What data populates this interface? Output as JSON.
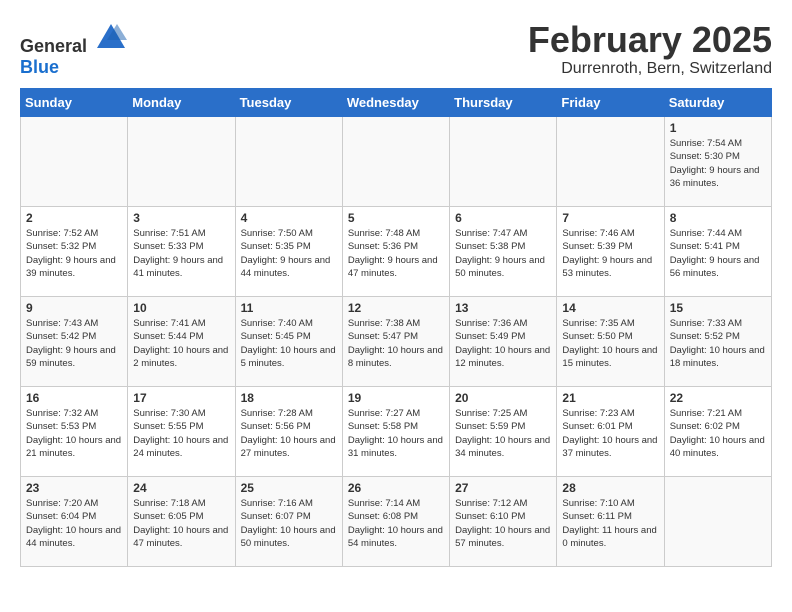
{
  "header": {
    "logo_general": "General",
    "logo_blue": "Blue",
    "title": "February 2025",
    "subtitle": "Durrenroth, Bern, Switzerland"
  },
  "days_of_week": [
    "Sunday",
    "Monday",
    "Tuesday",
    "Wednesday",
    "Thursday",
    "Friday",
    "Saturday"
  ],
  "weeks": [
    [
      {
        "day": "",
        "info": ""
      },
      {
        "day": "",
        "info": ""
      },
      {
        "day": "",
        "info": ""
      },
      {
        "day": "",
        "info": ""
      },
      {
        "day": "",
        "info": ""
      },
      {
        "day": "",
        "info": ""
      },
      {
        "day": "1",
        "info": "Sunrise: 7:54 AM\nSunset: 5:30 PM\nDaylight: 9 hours and 36 minutes."
      }
    ],
    [
      {
        "day": "2",
        "info": "Sunrise: 7:52 AM\nSunset: 5:32 PM\nDaylight: 9 hours and 39 minutes."
      },
      {
        "day": "3",
        "info": "Sunrise: 7:51 AM\nSunset: 5:33 PM\nDaylight: 9 hours and 41 minutes."
      },
      {
        "day": "4",
        "info": "Sunrise: 7:50 AM\nSunset: 5:35 PM\nDaylight: 9 hours and 44 minutes."
      },
      {
        "day": "5",
        "info": "Sunrise: 7:48 AM\nSunset: 5:36 PM\nDaylight: 9 hours and 47 minutes."
      },
      {
        "day": "6",
        "info": "Sunrise: 7:47 AM\nSunset: 5:38 PM\nDaylight: 9 hours and 50 minutes."
      },
      {
        "day": "7",
        "info": "Sunrise: 7:46 AM\nSunset: 5:39 PM\nDaylight: 9 hours and 53 minutes."
      },
      {
        "day": "8",
        "info": "Sunrise: 7:44 AM\nSunset: 5:41 PM\nDaylight: 9 hours and 56 minutes."
      }
    ],
    [
      {
        "day": "9",
        "info": "Sunrise: 7:43 AM\nSunset: 5:42 PM\nDaylight: 9 hours and 59 minutes."
      },
      {
        "day": "10",
        "info": "Sunrise: 7:41 AM\nSunset: 5:44 PM\nDaylight: 10 hours and 2 minutes."
      },
      {
        "day": "11",
        "info": "Sunrise: 7:40 AM\nSunset: 5:45 PM\nDaylight: 10 hours and 5 minutes."
      },
      {
        "day": "12",
        "info": "Sunrise: 7:38 AM\nSunset: 5:47 PM\nDaylight: 10 hours and 8 minutes."
      },
      {
        "day": "13",
        "info": "Sunrise: 7:36 AM\nSunset: 5:49 PM\nDaylight: 10 hours and 12 minutes."
      },
      {
        "day": "14",
        "info": "Sunrise: 7:35 AM\nSunset: 5:50 PM\nDaylight: 10 hours and 15 minutes."
      },
      {
        "day": "15",
        "info": "Sunrise: 7:33 AM\nSunset: 5:52 PM\nDaylight: 10 hours and 18 minutes."
      }
    ],
    [
      {
        "day": "16",
        "info": "Sunrise: 7:32 AM\nSunset: 5:53 PM\nDaylight: 10 hours and 21 minutes."
      },
      {
        "day": "17",
        "info": "Sunrise: 7:30 AM\nSunset: 5:55 PM\nDaylight: 10 hours and 24 minutes."
      },
      {
        "day": "18",
        "info": "Sunrise: 7:28 AM\nSunset: 5:56 PM\nDaylight: 10 hours and 27 minutes."
      },
      {
        "day": "19",
        "info": "Sunrise: 7:27 AM\nSunset: 5:58 PM\nDaylight: 10 hours and 31 minutes."
      },
      {
        "day": "20",
        "info": "Sunrise: 7:25 AM\nSunset: 5:59 PM\nDaylight: 10 hours and 34 minutes."
      },
      {
        "day": "21",
        "info": "Sunrise: 7:23 AM\nSunset: 6:01 PM\nDaylight: 10 hours and 37 minutes."
      },
      {
        "day": "22",
        "info": "Sunrise: 7:21 AM\nSunset: 6:02 PM\nDaylight: 10 hours and 40 minutes."
      }
    ],
    [
      {
        "day": "23",
        "info": "Sunrise: 7:20 AM\nSunset: 6:04 PM\nDaylight: 10 hours and 44 minutes."
      },
      {
        "day": "24",
        "info": "Sunrise: 7:18 AM\nSunset: 6:05 PM\nDaylight: 10 hours and 47 minutes."
      },
      {
        "day": "25",
        "info": "Sunrise: 7:16 AM\nSunset: 6:07 PM\nDaylight: 10 hours and 50 minutes."
      },
      {
        "day": "26",
        "info": "Sunrise: 7:14 AM\nSunset: 6:08 PM\nDaylight: 10 hours and 54 minutes."
      },
      {
        "day": "27",
        "info": "Sunrise: 7:12 AM\nSunset: 6:10 PM\nDaylight: 10 hours and 57 minutes."
      },
      {
        "day": "28",
        "info": "Sunrise: 7:10 AM\nSunset: 6:11 PM\nDaylight: 11 hours and 0 minutes."
      },
      {
        "day": "",
        "info": ""
      }
    ]
  ]
}
